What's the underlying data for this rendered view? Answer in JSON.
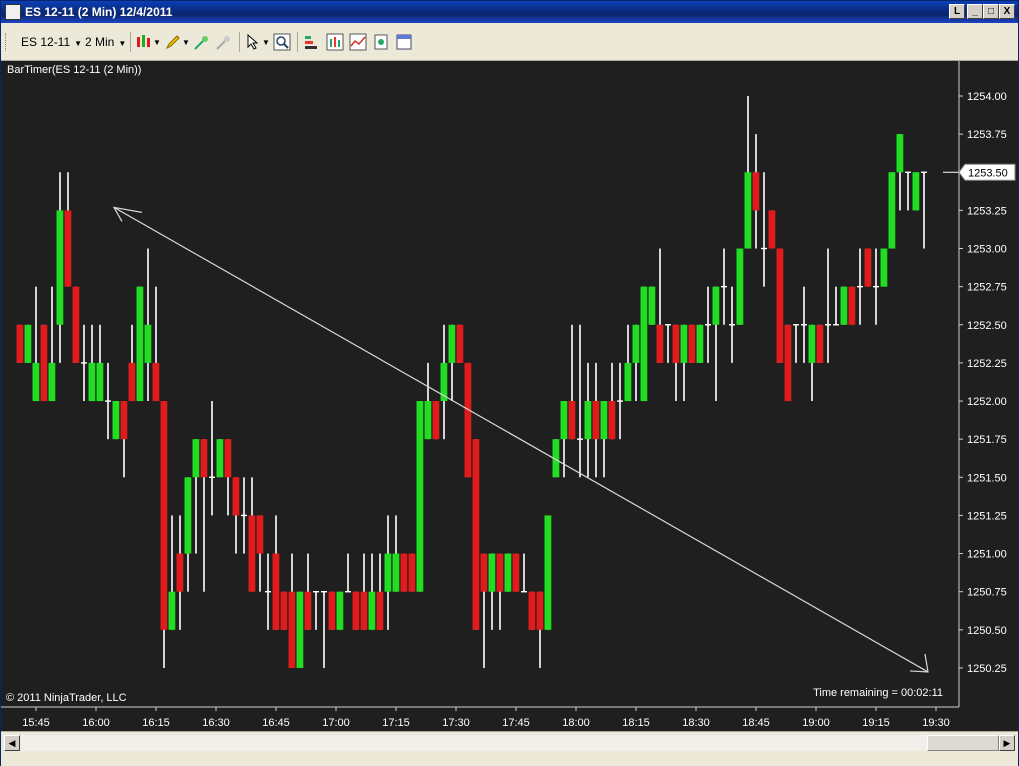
{
  "window": {
    "title": "ES 12-11 (2 Min)  12/4/2011",
    "btn_help": "L",
    "btn_min": "_",
    "btn_max": "□",
    "btn_close": "X"
  },
  "toolbar": {
    "instrument": "ES 12-11",
    "interval": "2 Min",
    "icons": [
      "chart-style-icon",
      "pencil-draw-icon",
      "crosshair-icon",
      "disabled-tool-icon",
      "pointer-icon",
      "zoom-icon",
      "data-series-icon",
      "bar-chart-icon",
      "indicators-icon",
      "strategy-icon",
      "properties-icon"
    ]
  },
  "indicator_label": "BarTimer(ES 12-11 (2 Min))",
  "copyright": "© 2011 NinjaTrader, LLC",
  "time_remaining": "Time remaining = 00:02:11",
  "colors": {
    "up": "#22dd22",
    "down": "#e01b1b",
    "doji": "#ffffff",
    "background": "#1f1f1f",
    "axis_text": "#ffffff"
  },
  "chart_data": {
    "type": "candlestick",
    "y_ticks": [
      "1254.00",
      "1253.75",
      "1253.50",
      "1253.25",
      "1253.00",
      "1252.75",
      "1252.50",
      "1252.25",
      "1252.00",
      "1251.75",
      "1251.50",
      "1251.25",
      "1251.00",
      "1250.75",
      "1250.50",
      "1250.25"
    ],
    "y_range": [
      1250.0,
      1254.25
    ],
    "current_price": "1253.50",
    "x_ticks": [
      "15:45",
      "16:00",
      "16:15",
      "16:30",
      "16:45",
      "17:00",
      "17:15",
      "17:30",
      "17:45",
      "18:00",
      "18:15",
      "18:30",
      "18:45",
      "19:00",
      "19:15",
      "19:30"
    ],
    "bars_per_tick": 7.5,
    "first_tick_bar": 2,
    "candles": [
      [
        1252.5,
        1252.5,
        1252.25,
        1252.25
      ],
      [
        1252.25,
        1252.5,
        1252.25,
        1252.5
      ],
      [
        1252.0,
        1252.75,
        1252.0,
        1252.25
      ],
      [
        1252.5,
        1252.5,
        1252.0,
        1252.0
      ],
      [
        1252.0,
        1252.75,
        1252.0,
        1252.25
      ],
      [
        1252.5,
        1253.5,
        1252.25,
        1253.25
      ],
      [
        1253.25,
        1253.5,
        1252.75,
        1252.75
      ],
      [
        1252.75,
        1252.75,
        1252.25,
        1252.25
      ],
      [
        1252.25,
        1252.5,
        1252.0,
        1252.25
      ],
      [
        1252.0,
        1252.5,
        1252.0,
        1252.25
      ],
      [
        1252.0,
        1252.5,
        1252.0,
        1252.25
      ],
      [
        1252.0,
        1252.25,
        1251.75,
        1252.0
      ],
      [
        1251.75,
        1252.0,
        1251.75,
        1252.0
      ],
      [
        1252.0,
        1252.0,
        1251.5,
        1251.75
      ],
      [
        1252.25,
        1252.5,
        1252.0,
        1252.0
      ],
      [
        1252.0,
        1252.75,
        1252.0,
        1252.75
      ],
      [
        1252.25,
        1253.0,
        1252.0,
        1252.5
      ],
      [
        1252.25,
        1252.75,
        1252.0,
        1252.0
      ],
      [
        1252.0,
        1252.0,
        1250.25,
        1250.5
      ],
      [
        1250.5,
        1251.25,
        1250.5,
        1250.75
      ],
      [
        1251.0,
        1251.25,
        1250.5,
        1250.75
      ],
      [
        1251.0,
        1251.5,
        1250.75,
        1251.5
      ],
      [
        1251.5,
        1251.75,
        1251.0,
        1251.75
      ],
      [
        1251.75,
        1251.75,
        1250.75,
        1251.5
      ],
      [
        1251.5,
        1252.0,
        1251.25,
        1251.5
      ],
      [
        1251.5,
        1251.75,
        1251.5,
        1251.75
      ],
      [
        1251.75,
        1251.75,
        1251.25,
        1251.5
      ],
      [
        1251.5,
        1251.5,
        1251.0,
        1251.25
      ],
      [
        1251.25,
        1251.5,
        1251.0,
        1251.25
      ],
      [
        1251.25,
        1251.5,
        1250.75,
        1250.75
      ],
      [
        1251.25,
        1251.25,
        1250.75,
        1251.0
      ],
      [
        1250.75,
        1251.0,
        1250.5,
        1250.75
      ],
      [
        1251.0,
        1251.25,
        1250.5,
        1250.5
      ],
      [
        1250.75,
        1250.75,
        1250.5,
        1250.5
      ],
      [
        1250.75,
        1251.0,
        1250.25,
        1250.25
      ],
      [
        1250.25,
        1250.75,
        1250.25,
        1250.75
      ],
      [
        1250.75,
        1251.0,
        1250.5,
        1250.5
      ],
      [
        1250.75,
        1250.75,
        1250.5,
        1250.75
      ],
      [
        1250.75,
        1250.75,
        1250.25,
        1250.75
      ],
      [
        1250.75,
        1250.75,
        1250.5,
        1250.5
      ],
      [
        1250.5,
        1250.75,
        1250.5,
        1250.75
      ],
      [
        1250.75,
        1251.0,
        1250.75,
        1250.75
      ],
      [
        1250.75,
        1250.75,
        1250.5,
        1250.5
      ],
      [
        1250.75,
        1251.0,
        1250.5,
        1250.5
      ],
      [
        1250.5,
        1251.0,
        1250.5,
        1250.75
      ],
      [
        1250.75,
        1251.0,
        1250.5,
        1250.5
      ],
      [
        1250.75,
        1251.25,
        1250.5,
        1251.0
      ],
      [
        1250.75,
        1251.25,
        1250.75,
        1251.0
      ],
      [
        1251.0,
        1251.0,
        1250.75,
        1250.75
      ],
      [
        1251.0,
        1251.0,
        1250.75,
        1250.75
      ],
      [
        1250.75,
        1252.0,
        1250.75,
        1252.0
      ],
      [
        1251.75,
        1252.25,
        1251.75,
        1252.0
      ],
      [
        1252.0,
        1252.0,
        1251.75,
        1251.75
      ],
      [
        1252.0,
        1252.5,
        1251.75,
        1252.25
      ],
      [
        1252.25,
        1252.5,
        1252.0,
        1252.5
      ],
      [
        1252.5,
        1252.5,
        1252.25,
        1252.25
      ],
      [
        1252.25,
        1252.25,
        1251.5,
        1251.5
      ],
      [
        1251.75,
        1251.75,
        1250.5,
        1250.5
      ],
      [
        1251.0,
        1251.0,
        1250.25,
        1250.75
      ],
      [
        1250.75,
        1251.0,
        1250.5,
        1251.0
      ],
      [
        1251.0,
        1251.0,
        1250.5,
        1250.75
      ],
      [
        1250.75,
        1251.0,
        1250.75,
        1251.0
      ],
      [
        1251.0,
        1251.0,
        1250.75,
        1250.75
      ],
      [
        1250.75,
        1251.0,
        1250.75,
        1250.75
      ],
      [
        1250.75,
        1250.75,
        1250.5,
        1250.5
      ],
      [
        1250.75,
        1250.75,
        1250.25,
        1250.5
      ],
      [
        1250.5,
        1251.25,
        1250.5,
        1251.25
      ],
      [
        1251.5,
        1251.75,
        1251.5,
        1251.75
      ],
      [
        1251.75,
        1252.0,
        1251.5,
        1252.0
      ],
      [
        1252.0,
        1252.5,
        1251.75,
        1251.75
      ],
      [
        1251.75,
        1252.5,
        1251.5,
        1251.75
      ],
      [
        1251.75,
        1252.25,
        1251.5,
        1252.0
      ],
      [
        1252.0,
        1252.25,
        1251.5,
        1251.75
      ],
      [
        1251.75,
        1252.0,
        1251.5,
        1252.0
      ],
      [
        1252.0,
        1252.25,
        1251.75,
        1251.75
      ],
      [
        1252.0,
        1252.25,
        1251.75,
        1252.0
      ],
      [
        1252.0,
        1252.5,
        1252.0,
        1252.25
      ],
      [
        1252.25,
        1252.5,
        1252.0,
        1252.5
      ],
      [
        1252.0,
        1252.75,
        1252.0,
        1252.75
      ],
      [
        1252.5,
        1252.75,
        1252.5,
        1252.75
      ],
      [
        1252.5,
        1253.0,
        1252.25,
        1252.25
      ],
      [
        1252.5,
        1252.5,
        1252.25,
        1252.5
      ],
      [
        1252.5,
        1252.5,
        1252.0,
        1252.25
      ],
      [
        1252.25,
        1252.5,
        1252.0,
        1252.5
      ],
      [
        1252.5,
        1252.5,
        1252.25,
        1252.25
      ],
      [
        1252.25,
        1252.5,
        1252.25,
        1252.5
      ],
      [
        1252.5,
        1252.75,
        1252.25,
        1252.5
      ],
      [
        1252.5,
        1252.75,
        1252.0,
        1252.75
      ],
      [
        1252.75,
        1253.0,
        1252.5,
        1252.75
      ],
      [
        1252.5,
        1252.75,
        1252.25,
        1252.5
      ],
      [
        1252.5,
        1253.0,
        1252.5,
        1253.0
      ],
      [
        1253.0,
        1254.0,
        1253.0,
        1253.5
      ],
      [
        1253.5,
        1253.75,
        1253.0,
        1253.25
      ],
      [
        1253.0,
        1253.5,
        1252.75,
        1253.0
      ],
      [
        1253.25,
        1253.25,
        1253.0,
        1253.0
      ],
      [
        1253.0,
        1253.0,
        1252.25,
        1252.25
      ],
      [
        1252.5,
        1252.5,
        1252.0,
        1252.0
      ],
      [
        1252.5,
        1252.5,
        1252.25,
        1252.5
      ],
      [
        1252.5,
        1252.75,
        1252.25,
        1252.5
      ],
      [
        1252.25,
        1252.5,
        1252.0,
        1252.5
      ],
      [
        1252.5,
        1252.5,
        1252.25,
        1252.25
      ],
      [
        1252.5,
        1253.0,
        1252.25,
        1252.5
      ],
      [
        1252.5,
        1252.75,
        1252.5,
        1252.5
      ],
      [
        1252.5,
        1252.75,
        1252.5,
        1252.75
      ],
      [
        1252.75,
        1252.75,
        1252.5,
        1252.5
      ],
      [
        1252.75,
        1253.0,
        1252.5,
        1252.75
      ],
      [
        1253.0,
        1253.0,
        1252.75,
        1252.75
      ],
      [
        1252.75,
        1253.0,
        1252.5,
        1252.75
      ],
      [
        1252.75,
        1253.0,
        1252.75,
        1253.0
      ],
      [
        1253.0,
        1253.5,
        1253.0,
        1253.5
      ],
      [
        1253.5,
        1253.75,
        1253.25,
        1253.75
      ],
      [
        1253.5,
        1253.5,
        1253.25,
        1253.5
      ],
      [
        1253.25,
        1253.5,
        1253.25,
        1253.5
      ],
      [
        1253.5,
        1253.5,
        1253.0,
        1253.5
      ]
    ],
    "line_annotation": {
      "from": [
        "16:05",
        1253.25
      ],
      "to": [
        "19:28",
        1250.25
      ]
    }
  }
}
